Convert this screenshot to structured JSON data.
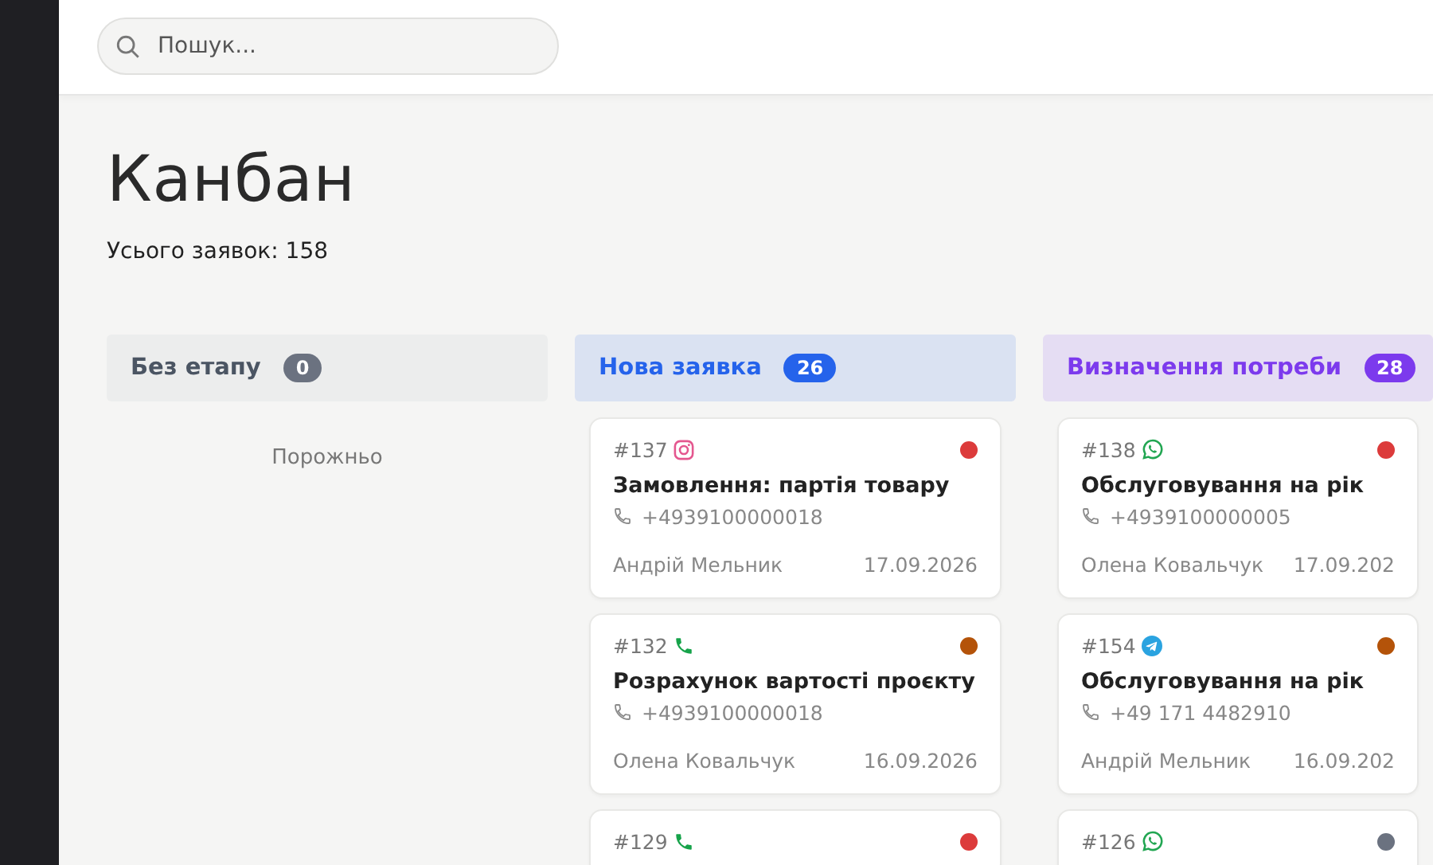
{
  "search": {
    "placeholder": "Пошук..."
  },
  "page": {
    "title": "Канбан",
    "subtitle": "Усього заявок: 158"
  },
  "columns": [
    {
      "title": "Без етапу",
      "count": "0",
      "color": "#6b7280",
      "empty_text": "Порожньо"
    },
    {
      "title": "Нова заявка",
      "count": "26",
      "color": "#2563eb",
      "cards": [
        {
          "number": "#137",
          "kind": "instagram",
          "color": "#dc3b3b",
          "title": "Замовлення: партія товару",
          "phone": "+4939100000018",
          "manager": "Андрій Мельник",
          "date": "17.09.2026"
        },
        {
          "number": "#132",
          "kind": "phone",
          "color": "#b45309",
          "title": "Розрахунок вартості проєкту",
          "phone": "+4939100000018",
          "manager": "Олена Ковальчук",
          "date": "16.09.2026"
        },
        {
          "number": "#129",
          "kind": "phone",
          "color": "#dc3b3b"
        }
      ]
    },
    {
      "title": "Визначення потреби",
      "count": "28",
      "color": "#7c3aed",
      "cards": [
        {
          "number": "#138",
          "kind": "whatsapp",
          "color": "#dc3b3b",
          "title": "Обслуговування на рік",
          "phone": "+4939100000005",
          "manager": "Олена Ковальчук",
          "date": "17.09.202"
        },
        {
          "number": "#154",
          "kind": "telegram",
          "color": "#b45309",
          "title": "Обслуговування на рік",
          "phone": "+49 171 4482910",
          "manager": "Андрій Мельник",
          "date": "16.09.202"
        },
        {
          "number": "#126",
          "kind": "whatsapp",
          "color": "#6b7280"
        }
      ]
    }
  ]
}
